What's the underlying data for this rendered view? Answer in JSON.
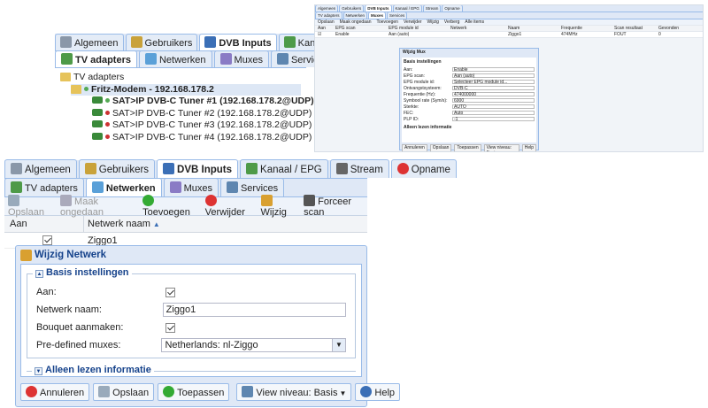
{
  "panel1": {
    "tabs": [
      {
        "label": "Algemeen",
        "icon": "gear-icon"
      },
      {
        "label": "Gebruikers",
        "icon": "users-icon"
      },
      {
        "label": "DVB Inputs",
        "icon": "dvb-icon",
        "active": true
      },
      {
        "label": "Kanaal / EPG",
        "icon": "tv-icon"
      }
    ],
    "subtabs": [
      {
        "label": "TV adapters",
        "active": true
      },
      {
        "label": "Netwerken"
      },
      {
        "label": "Muxes"
      },
      {
        "label": "Services"
      }
    ],
    "tree": {
      "root": "TV adapters",
      "device": "Fritz-Modem - 192.168.178.2",
      "tuners": [
        "SAT>IP DVB-C Tuner #1 (192.168.178.2@UDP)",
        "SAT>IP DVB-C Tuner #2 (192.168.178.2@UDP)",
        "SAT>IP DVB-C Tuner #3 (192.168.178.2@UDP)",
        "SAT>IP DVB-C Tuner #4 (192.168.178.2@UDP)"
      ]
    }
  },
  "panel2": {
    "tabs": [
      "Algemeen",
      "Gebruikers",
      "DVB Inputs",
      "Kanaal / EPG",
      "Stream",
      "Opname"
    ],
    "subtabs": [
      "TV adapters",
      "Netwerken",
      "Muxes",
      "Services"
    ],
    "toolbar": [
      "Opslaan",
      "Maak ongedaan",
      "Toevoegen",
      "Verwijder",
      "Wijzig",
      "Verberg",
      "Alle items"
    ],
    "columns": [
      "Aan",
      "EPG scan",
      "EPG module id",
      "Netwerk",
      "Naam",
      "Frequentie",
      "Scan resultaat",
      "Gevonden"
    ],
    "row": [
      "",
      "Enable",
      "Aan (auto)",
      "",
      "Ziggo1",
      "474MHz",
      "",
      "FOUT",
      "0"
    ],
    "dialog_title": "Wijzig Mux",
    "section": "Basis instellingen",
    "fields": [
      {
        "label": "Aan:",
        "value": "Enable"
      },
      {
        "label": "EPG scan:",
        "value": "Aan (auto)"
      },
      {
        "label": "EPG module id:",
        "value": "Selecteer EPG module id..."
      },
      {
        "label": "Ontvangstsysteem:",
        "value": "DVB-C"
      },
      {
        "label": "Frequentie (Hz):",
        "value": "474000000"
      },
      {
        "label": "Symbool rate (Sym/s):",
        "value": "6900"
      },
      {
        "label": "Sterkte:",
        "value": "AUTO"
      },
      {
        "label": "FEC:",
        "value": "Auto"
      },
      {
        "label": "PLP ID:",
        "value": "-1"
      }
    ],
    "readonly": "Alleen lezen informatie",
    "buttons": [
      "Annuleren",
      "Opslaan",
      "Toepassen",
      "View niveau: Basis",
      "Help"
    ]
  },
  "panel3": {
    "tabs": [
      {
        "label": "Algemeen",
        "icon": "gear-icon"
      },
      {
        "label": "Gebruikers",
        "icon": "users-icon"
      },
      {
        "label": "DVB Inputs",
        "icon": "dvb-icon",
        "active": true
      },
      {
        "label": "Kanaal / EPG",
        "icon": "tv-icon"
      },
      {
        "label": "Stream",
        "icon": "stream-icon"
      },
      {
        "label": "Opname",
        "icon": "record-icon"
      }
    ],
    "subtabs": [
      {
        "label": "TV adapters"
      },
      {
        "label": "Netwerken",
        "active": true
      },
      {
        "label": "Muxes"
      },
      {
        "label": "Services"
      }
    ],
    "toolbar": {
      "save": "Opslaan",
      "undo": "Maak ongedaan",
      "add": "Toevoegen",
      "delete": "Verwijder",
      "edit": "Wijzig",
      "scan": "Forceer scan"
    },
    "grid": {
      "col_enabled": "Aan",
      "col_name": "Netwerk naam",
      "row_name": "Ziggo1"
    },
    "dialog": {
      "title": "Wijzig Netwerk",
      "section": "Basis instellingen",
      "enabled_label": "Aan:",
      "name_label": "Netwerk naam:",
      "name_value": "Ziggo1",
      "bouquet_label": "Bouquet aanmaken:",
      "muxes_label": "Pre-defined muxes:",
      "muxes_value": "Netherlands: nl-Ziggo",
      "readonly": "Alleen lezen informatie",
      "cancel": "Annuleren",
      "save": "Opslaan",
      "apply": "Toepassen",
      "view": "View niveau: Basis",
      "help": "Help"
    }
  }
}
